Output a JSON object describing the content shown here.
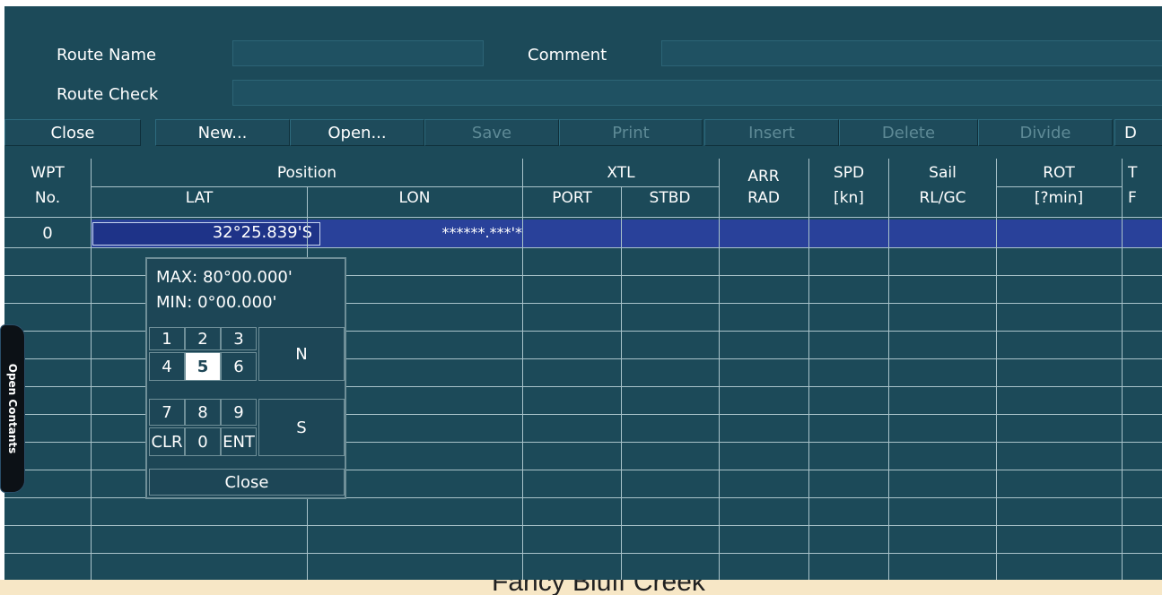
{
  "form": {
    "route_name_label": "Route Name",
    "route_name_value": "",
    "comment_label": "Comment",
    "comment_value": "",
    "route_check_label": "Route Check",
    "route_check_value": ""
  },
  "toolbar": {
    "close": "Close",
    "new": "New...",
    "open": "Open...",
    "save": "Save",
    "print": "Print",
    "insert": "Insert",
    "delete": "Delete",
    "divide": "Divide",
    "truncated": "D"
  },
  "table": {
    "headers": {
      "wpt": "WPT",
      "no": "No.",
      "position": "Position",
      "lat": "LAT",
      "lon": "LON",
      "xtl": "XTL",
      "port": "PORT",
      "stbd": "STBD",
      "arr": "ARR",
      "rad": "RAD",
      "spd": "SPD",
      "kn": "[kn]",
      "sail": "Sail",
      "rlgc": "RL/GC",
      "rot": "ROT",
      "rot_unit": "[?min]",
      "extra_top": "T",
      "extra_bottom": "F"
    },
    "rows": [
      {
        "no": "0",
        "lat": "32°25.839'S",
        "lon": "******.***'*"
      }
    ]
  },
  "keypad": {
    "max": "MAX: 80°00.000'",
    "min": "MIN: 0°00.000'",
    "keys": [
      "1",
      "2",
      "3",
      "4",
      "5",
      "6",
      "7",
      "8",
      "9",
      "CLR",
      "0",
      "ENT"
    ],
    "n": "N",
    "s": "S",
    "close": "Close",
    "selected": "5"
  },
  "side_tab": {
    "label": "Open Contants"
  },
  "chart_bg": {
    "text": "Fancy Bluff Creek"
  }
}
